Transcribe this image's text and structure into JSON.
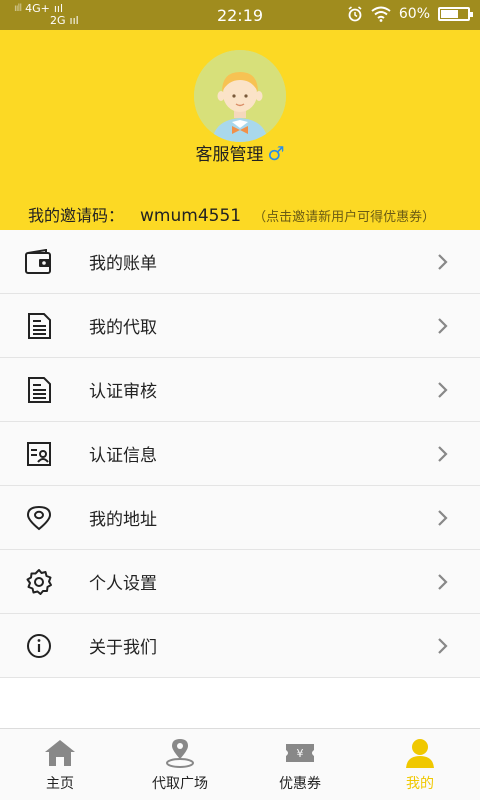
{
  "status_bar": {
    "network_top": "4G+",
    "network_bottom": "2G",
    "time": "22:19",
    "battery_text": "60%",
    "battery_level": 0.6
  },
  "profile": {
    "username": "客服管理",
    "gender_symbol": "♂",
    "invite_label": "我的邀请码：",
    "invite_code": "wmum4551",
    "invite_hint": "（点击邀请新用户可得优惠券）"
  },
  "menu": {
    "items": [
      {
        "label": "我的账单",
        "icon": "wallet-icon"
      },
      {
        "label": "我的代取",
        "icon": "document-icon"
      },
      {
        "label": "认证审核",
        "icon": "document-icon"
      },
      {
        "label": "认证信息",
        "icon": "id-card-icon"
      },
      {
        "label": "我的地址",
        "icon": "location-icon"
      },
      {
        "label": "个人设置",
        "icon": "gear-icon"
      },
      {
        "label": "关于我们",
        "icon": "info-icon"
      }
    ]
  },
  "tabbar": {
    "tabs": [
      {
        "label": "主页",
        "icon": "home-icon"
      },
      {
        "label": "代取广场",
        "icon": "location-pin-icon"
      },
      {
        "label": "优惠券",
        "icon": "coupon-icon"
      },
      {
        "label": "我的",
        "icon": "person-icon"
      }
    ],
    "active_index": 3
  },
  "colors": {
    "header_bg": "#fcd924",
    "status_bar_bg": "#a08c1e",
    "active_tab": "#f0c800",
    "gender_icon": "#2a8de8"
  }
}
